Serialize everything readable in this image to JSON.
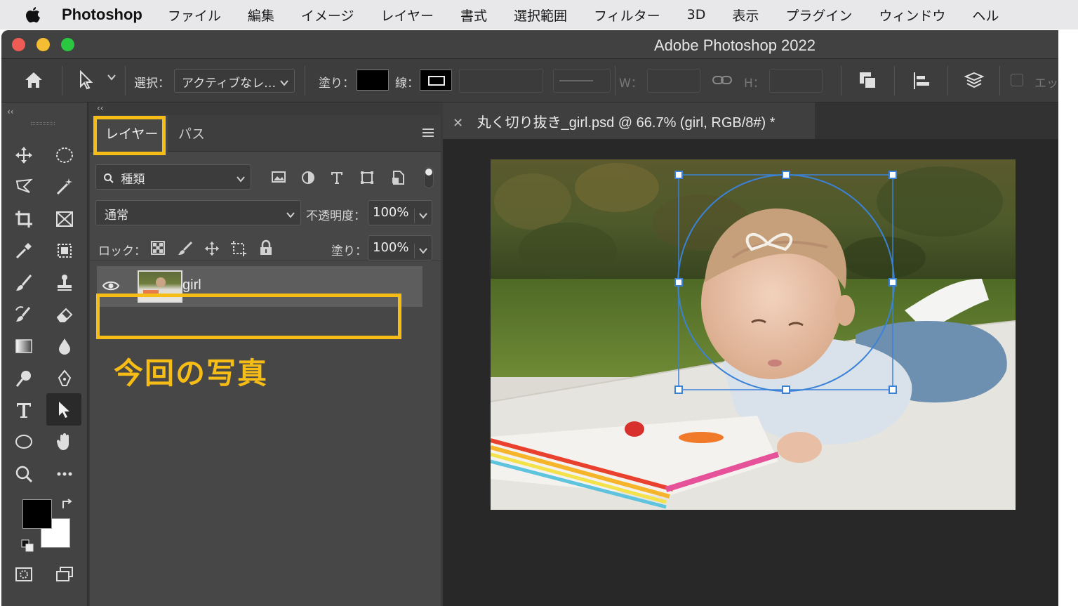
{
  "menubar": {
    "app_name": "Photoshop",
    "items": [
      "ファイル",
      "編集",
      "イメージ",
      "レイヤー",
      "書式",
      "選択範囲",
      "フィルター",
      "3D",
      "表示",
      "プラグイン",
      "ウィンドウ",
      "ヘル"
    ]
  },
  "window": {
    "title": "Adobe Photoshop 2022"
  },
  "options": {
    "select_label": "選択：",
    "select_value": "アクティブなレ…",
    "fill_label": "塗り：",
    "stroke_label": "線：",
    "w_label": "W：",
    "h_label": "H：",
    "edge_label": "エッ"
  },
  "layers_panel": {
    "tabs": [
      "レイヤー",
      "パス"
    ],
    "filter_placeholder": "種類",
    "blend_mode": "通常",
    "opacity_label": "不透明度：",
    "opacity_value": "100%",
    "lock_label": "ロック：",
    "fill_label": "塗り：",
    "fill_value": "100%",
    "layers": [
      {
        "name": "girl",
        "visible": true
      }
    ]
  },
  "annotation": "今回の写真",
  "document": {
    "tab_title": "丸く切り抜き_girl.psd @ 66.7% (girl, RGB/8#) *"
  },
  "colors": {
    "highlight": "#f6bd16",
    "selection": "#3b82d6",
    "foreground": "#000000",
    "background": "#ffffff"
  }
}
